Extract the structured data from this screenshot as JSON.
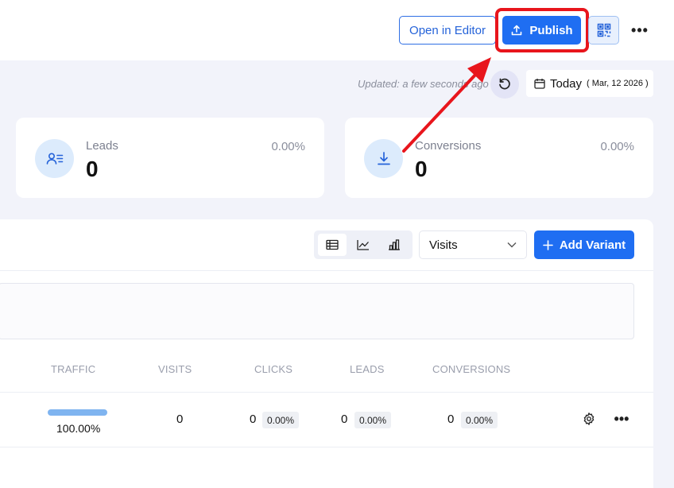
{
  "header": {
    "open_in_editor_label": "Open in Editor",
    "publish_label": "Publish",
    "more_label": "•••"
  },
  "status": {
    "updated_text": "Updated: a few seconds ago",
    "today_label": "Today",
    "date_text": "( Mar, 12 2026 )"
  },
  "stats": {
    "leads": {
      "label": "Leads",
      "value": "0",
      "percent": "0.00%"
    },
    "conversions": {
      "label": "Conversions",
      "value": "0",
      "percent": "0.00%"
    }
  },
  "toolbar": {
    "metric_select_value": "Visits",
    "add_variant_label": "Add Variant"
  },
  "table": {
    "columns": [
      "TRAFFIC",
      "VISITS",
      "CLICKS",
      "LEADS",
      "CONVERSIONS"
    ],
    "row": {
      "traffic": "100.00%",
      "traffic_fraction": 1.0,
      "visits": "0",
      "clicks": "0",
      "clicks_pct": "0.00%",
      "leads": "0",
      "leads_pct": "0.00%",
      "conversions": "0",
      "conversions_pct": "0.00%",
      "more_label": "•••"
    }
  },
  "colors": {
    "primary": "#1f6ef2",
    "annotation_red": "#e8151c",
    "icon_circle": "#dcebfc",
    "traffic_bar": "#7fb4f0"
  },
  "icons": [
    "upload-icon",
    "qr-code-icon",
    "more-icon",
    "refresh-icon",
    "calendar-icon",
    "user-list-icon",
    "download-icon",
    "table-view-icon",
    "line-chart-icon",
    "bar-chart-icon",
    "chevron-down-icon",
    "plus-icon",
    "gear-icon"
  ]
}
